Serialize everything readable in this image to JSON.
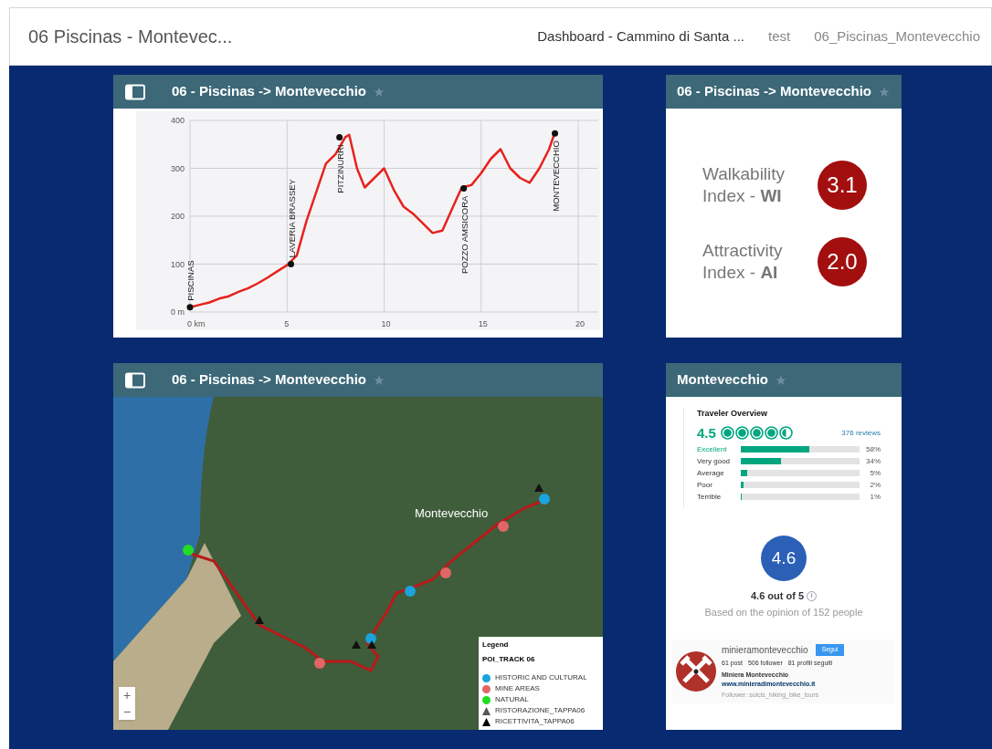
{
  "top_bar": {
    "title": "06 Piscinas - Montevec...",
    "breadcrumbs": [
      "Dashboard - Cammino di Santa ...",
      "test",
      "06_Piscinas_Montevecchio"
    ]
  },
  "elevation_widget": {
    "title": "06 - Piscinas -> Montevecchio",
    "chart_data": {
      "type": "line",
      "x": [
        0,
        0.5,
        1,
        1.5,
        2,
        2.5,
        3,
        3.5,
        4,
        4.5,
        5,
        5.5,
        6,
        6.5,
        7,
        7.5,
        8,
        8.2,
        8.6,
        9,
        9.5,
        10,
        10.5,
        11,
        11.5,
        12,
        12.5,
        13,
        13.5,
        14,
        14.5,
        15,
        15.5,
        16,
        16.5,
        17,
        17.5,
        18,
        18.5,
        18.8
      ],
      "grid": true,
      "series": [
        {
          "color": "#e8211c",
          "values": [
            10,
            15,
            20,
            28,
            33,
            42,
            50,
            60,
            72,
            85,
            98,
            118,
            190,
            250,
            310,
            330,
            365,
            370,
            300,
            260,
            280,
            300,
            255,
            220,
            205,
            185,
            165,
            170,
            215,
            260,
            265,
            290,
            320,
            340,
            300,
            280,
            270,
            300,
            340,
            375
          ]
        }
      ],
      "xlim": [
        0,
        21
      ],
      "ylim": [
        0,
        400
      ],
      "xticks": [
        {
          "value": 0,
          "label": "0 km"
        },
        5,
        10,
        15,
        20
      ],
      "yticks": [
        {
          "value": 0,
          "label": "0 m"
        },
        100,
        200,
        300,
        400
      ],
      "annotations": [
        {
          "x": 0,
          "y": 10,
          "text": "PISCINAS"
        },
        {
          "x": 5.2,
          "y": 100,
          "text": "LAVERIA BRASSEY"
        },
        {
          "x": 7.7,
          "y": 365,
          "text": "PITZINURRI"
        },
        {
          "x": 14.1,
          "y": 258,
          "text": "POZZO AMSICORA"
        },
        {
          "x": 18.8,
          "y": 373,
          "text": "MONTEVECCHIO"
        }
      ]
    }
  },
  "index_widget": {
    "title": "06 - Piscinas -> Montevecchio",
    "indices": [
      {
        "label": "Walkability\nIndex - **WI**",
        "value": "3.1"
      },
      {
        "label": "Attractivity\nIndex - **AI**",
        "value": "2.0"
      }
    ]
  },
  "map_widget": {
    "title": "06 - Piscinas -> Montevecchio",
    "place_label": "Montevecchio",
    "zoom_in": "+",
    "zoom_out": "−",
    "legend": {
      "title": "Legend",
      "layer": "POI_TRACK 06",
      "items": [
        {
          "kind": "circle",
          "color": "#1aa3dc",
          "label": "HISTORIC AND CULTURAL"
        },
        {
          "kind": "circle",
          "color": "#e06666",
          "label": "MINE AREAS"
        },
        {
          "kind": "circle",
          "color": "#22dd22",
          "label": "NATURAL"
        },
        {
          "kind": "triangle",
          "color": "#555555",
          "label": "RISTORAZIONE_TAPPA06"
        },
        {
          "kind": "triangle",
          "color": "#000000",
          "label": "RICETTIVITA_TAPPA06"
        }
      ]
    }
  },
  "review_widget": {
    "title": "Montevecchio",
    "overview": {
      "heading": "Traveler Overview",
      "score": "4.5",
      "stars": 4.5,
      "reviews": "376 reviews",
      "rows": [
        {
          "label": "Excellent",
          "level": 0.58,
          "percent": "58%",
          "selected": true
        },
        {
          "label": "Very good",
          "level": 0.34,
          "percent": "34%",
          "selected": false
        },
        {
          "label": "Average",
          "level": 0.05,
          "percent": "5%",
          "selected": false
        },
        {
          "label": "Poor",
          "level": 0.02,
          "percent": "2%",
          "selected": false
        },
        {
          "label": "Terrible",
          "level": 0.01,
          "percent": "1%",
          "selected": false
        }
      ]
    },
    "rating": {
      "value": "4.6",
      "summary": "4.6 out of 5",
      "info": "i",
      "basis": "Based on the opinion of 152 people"
    },
    "profile": {
      "username": "minieramontevecchio",
      "follow": "Segui",
      "stats": [
        "61 post",
        "506 follower",
        "81 profili seguiti"
      ],
      "name": "Miniera Montevecchio",
      "link": "www.minieradimontevecchio.it",
      "followers": "Follower: sulcis_hiking_bike_tours"
    }
  }
}
